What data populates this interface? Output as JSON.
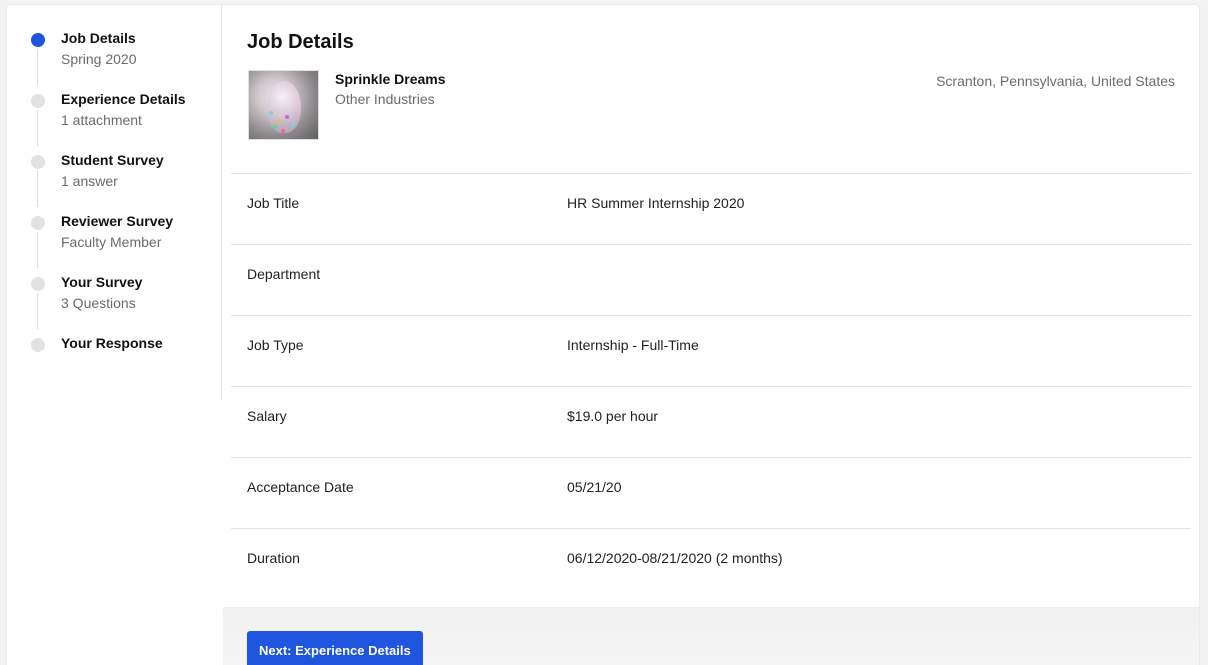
{
  "stepper": {
    "steps": [
      {
        "title": "Job Details",
        "subtitle": "Spring 2020",
        "active": true
      },
      {
        "title": "Experience Details",
        "subtitle": "1 attachment",
        "active": false
      },
      {
        "title": "Student Survey",
        "subtitle": "1 answer",
        "active": false
      },
      {
        "title": "Reviewer Survey",
        "subtitle": "Faculty Member",
        "active": false
      },
      {
        "title": "Your Survey",
        "subtitle": "3 Questions",
        "active": false
      },
      {
        "title": "Your Response",
        "subtitle": "",
        "active": false
      }
    ]
  },
  "main": {
    "title": "Job Details",
    "company": {
      "name": "Sprinkle Dreams",
      "industry": "Other Industries",
      "location": "Scranton, Pennsylvania, United States"
    },
    "details": [
      {
        "label": "Job Title",
        "value": "HR Summer Internship 2020"
      },
      {
        "label": "Department",
        "value": ""
      },
      {
        "label": "Job Type",
        "value": "Internship - Full-Time"
      },
      {
        "label": "Salary",
        "value": "$19.0 per hour"
      },
      {
        "label": "Acceptance Date",
        "value": "05/21/20"
      },
      {
        "label": "Duration",
        "value": "06/12/2020-08/21/2020 (2 months)"
      }
    ],
    "next_button_label": "Next: Experience Details"
  },
  "colors": {
    "accent": "#1f55de",
    "inactive_dot": "#e2e2e2"
  }
}
